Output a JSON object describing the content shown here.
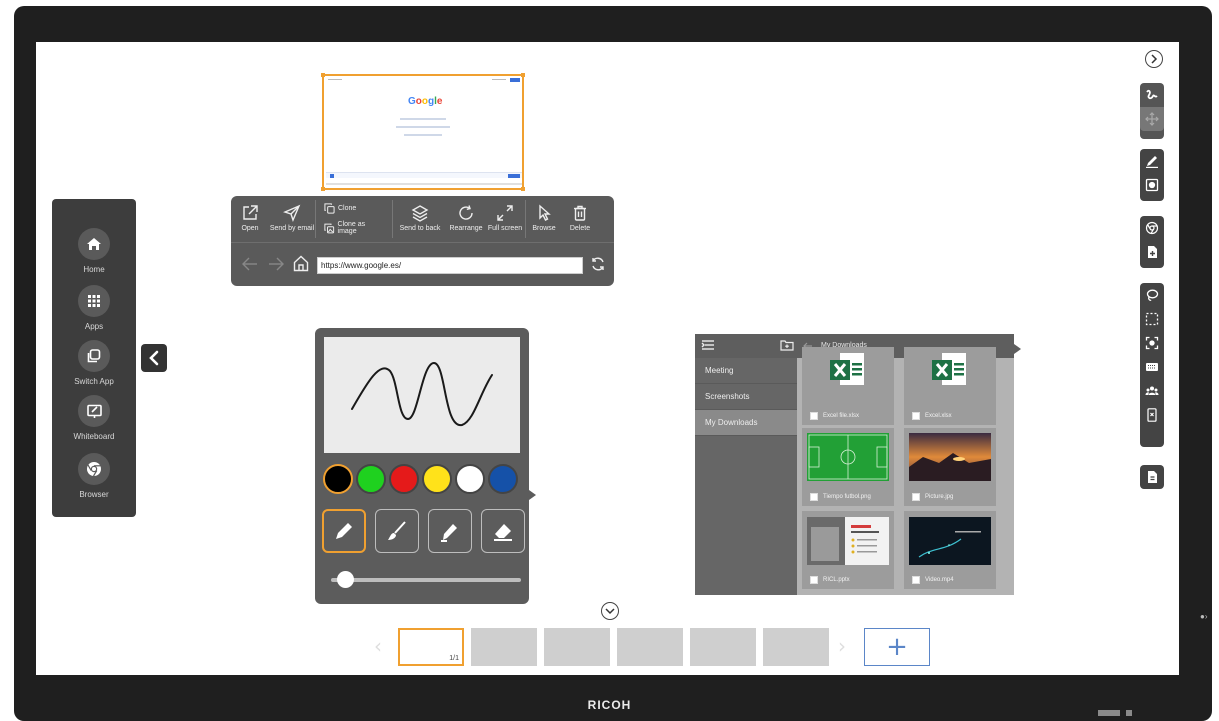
{
  "device": {
    "brand": "RICOH"
  },
  "dock": {
    "items": [
      {
        "label": "Home",
        "icon": "home-icon"
      },
      {
        "label": "Apps",
        "icon": "apps-grid-icon"
      },
      {
        "label": "Switch App",
        "icon": "switch-app-icon"
      },
      {
        "label": "Whiteboard",
        "icon": "whiteboard-icon"
      },
      {
        "label": "Browser",
        "icon": "browser-icon"
      }
    ]
  },
  "browser": {
    "page_logo": "Google",
    "toolbar": {
      "open": "Open",
      "send_by_email": "Send by email",
      "clone": "Clone",
      "clone_as_image": "Clone as image",
      "send_to_back": "Send to back",
      "rearrange": "Rearrange",
      "full_screen": "Full screen",
      "browse": "Browse",
      "delete": "Delete"
    },
    "address": "https://www.google.es/"
  },
  "pen": {
    "colors": [
      "#000000",
      "#1fd11f",
      "#e51a1a",
      "#ffe21a",
      "#ffffff",
      "#1551a8"
    ],
    "selected_color_index": 0,
    "tools": [
      "pencil-icon",
      "brush-icon",
      "marker-icon",
      "eraser-icon"
    ],
    "selected_tool_index": 0,
    "size": 0.05
  },
  "files": {
    "path": "My Downloads",
    "folders": [
      "Meeting",
      "Screenshots",
      "My Downloads"
    ],
    "selected_folder": "My Downloads",
    "items": [
      {
        "name": "Excel file.xlsx",
        "type": "xlsx"
      },
      {
        "name": "Excel.xlsx",
        "type": "xlsx"
      },
      {
        "name": "Tiempo futbol.png",
        "type": "image"
      },
      {
        "name": "Picture.jpg",
        "type": "image"
      },
      {
        "name": "RICL.pptx",
        "type": "pptx"
      },
      {
        "name": "Video.mp4",
        "type": "video"
      }
    ]
  },
  "pages": {
    "current_indicator": "1/1",
    "add_label": "+"
  },
  "colors": {
    "accent": "#f0a030",
    "panel": "#5c5c5c",
    "add_page": "#5b86c8"
  }
}
